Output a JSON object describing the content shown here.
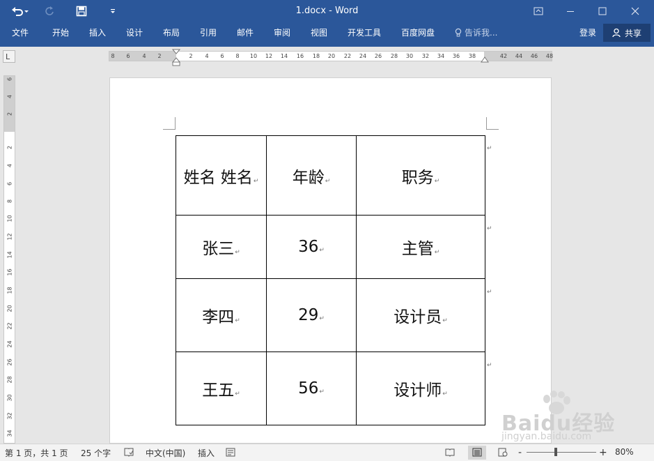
{
  "titlebar": {
    "title": "1.docx - Word",
    "undo_icon": "undo-icon",
    "redo_icon": "redo-icon",
    "save_icon": "save-icon",
    "customize_icon": "customize-qat-icon",
    "ribbon_display_icon": "ribbon-display-options-icon",
    "minimize_icon": "minimize-icon",
    "maximize_icon": "maximize-icon",
    "close_icon": "close-icon"
  },
  "ribbon": {
    "tabs": [
      "文件",
      "开始",
      "插入",
      "设计",
      "布局",
      "引用",
      "邮件",
      "审阅",
      "视图",
      "开发工具",
      "百度网盘"
    ],
    "tell_me": "告诉我...",
    "login": "登录",
    "share": "共享"
  },
  "rulers": {
    "corner_label": "L",
    "horizontal_left": [
      "8",
      "6",
      "4",
      "2"
    ],
    "horizontal_main": [
      "2",
      "4",
      "6",
      "8",
      "10",
      "12",
      "14",
      "16",
      "18",
      "20",
      "22",
      "24",
      "26",
      "28",
      "30",
      "32",
      "34",
      "36",
      "38"
    ],
    "horizontal_right": [
      "42",
      "44",
      "46",
      "48"
    ],
    "vertical_top": [
      "6",
      "4",
      "2"
    ],
    "vertical_main": [
      "2",
      "4",
      "6",
      "8",
      "10",
      "12",
      "14",
      "16",
      "18",
      "20",
      "22",
      "24",
      "26",
      "28",
      "30",
      "32",
      "34"
    ]
  },
  "document": {
    "table": [
      [
        "姓名  姓名",
        "年龄",
        "职务"
      ],
      [
        "张三",
        "36",
        "主管"
      ],
      [
        "李四",
        "29",
        "设计员"
      ],
      [
        "王五",
        "56",
        "设计师"
      ]
    ],
    "cell_mark": "↵",
    "row_end_mark": "↵"
  },
  "statusbar": {
    "page_info": "第 1 页，共 1 页",
    "word_count": "25 个字",
    "language": "中文(中国)",
    "insert_mode": "插入",
    "zoom_minus": "-",
    "zoom_plus": "+",
    "zoom": "80%"
  },
  "watermark": {
    "brand": "Baidu经验",
    "url": "jingyan.baidu.com"
  }
}
